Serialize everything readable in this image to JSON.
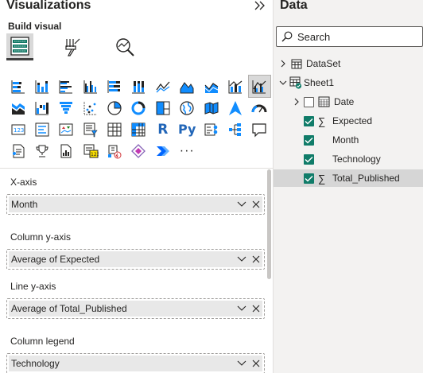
{
  "visualizations": {
    "title": "Visualizations",
    "build_label": "Build visual",
    "more_label": "···",
    "wells": [
      {
        "label": "X-axis",
        "value": "Month"
      },
      {
        "label": "Column y-axis",
        "value": "Average of Expected"
      },
      {
        "label": "Line y-axis",
        "value": "Average of Total_Published"
      },
      {
        "label": "Column legend",
        "value": "Technology"
      }
    ],
    "selected_visual": "line-and-clustered-column-chart-icon",
    "r_visual_label": "R",
    "py_visual_label": "Py"
  },
  "data": {
    "title": "Data",
    "search_placeholder": "Search",
    "tree": {
      "dataset": "DataSet",
      "sheet": "Sheet1",
      "fields": [
        {
          "name": "Date",
          "checked": false,
          "sigma": false,
          "expandable": true
        },
        {
          "name": "Expected",
          "checked": true,
          "sigma": true
        },
        {
          "name": "Month",
          "checked": true,
          "sigma": false
        },
        {
          "name": "Technology",
          "checked": true,
          "sigma": false
        },
        {
          "name": "Total_Published",
          "checked": true,
          "sigma": true,
          "selected": true
        }
      ]
    }
  },
  "colors": {
    "accent_teal": "#107c69",
    "selection_gray": "#d9d9d9",
    "pane_bg": "#f3f2f1"
  }
}
